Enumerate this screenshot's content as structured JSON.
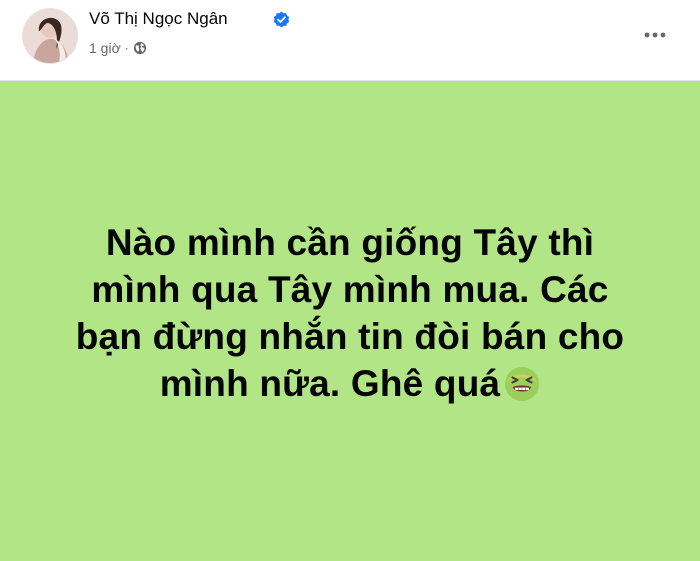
{
  "post": {
    "author_name": "Võ Thị Ngọc Ngân",
    "verified": true,
    "timestamp": "1 giờ",
    "separator": "·",
    "privacy_icon": "globe-icon",
    "more_icon": "more-options-icon",
    "background_color": "#b2e586",
    "text_lines": [
      "Nào mình cần giống Tây thì",
      "mình qua Tây mình mua. Các",
      "bạn đừng nhắn tin đòi bán cho",
      "mình nữa. Ghê quá"
    ],
    "emoji": "nauseated-face-emoji"
  }
}
